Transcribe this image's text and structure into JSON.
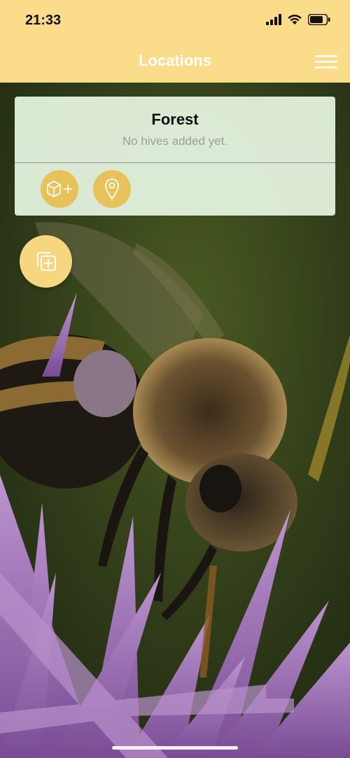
{
  "status": {
    "time": "21:33"
  },
  "nav": {
    "title": "Locations"
  },
  "location_card": {
    "title": "Forest",
    "subtitle": "No hives added yet."
  },
  "icons": {
    "menu": "hamburger-menu-icon",
    "add_hive": "box-plus-icon",
    "location": "map-pin-icon",
    "add_location": "copy-plus-icon"
  },
  "colors": {
    "header": "#fbdc8a",
    "accent_button": "#e6c25a",
    "card_background": "#e2f0dc"
  }
}
